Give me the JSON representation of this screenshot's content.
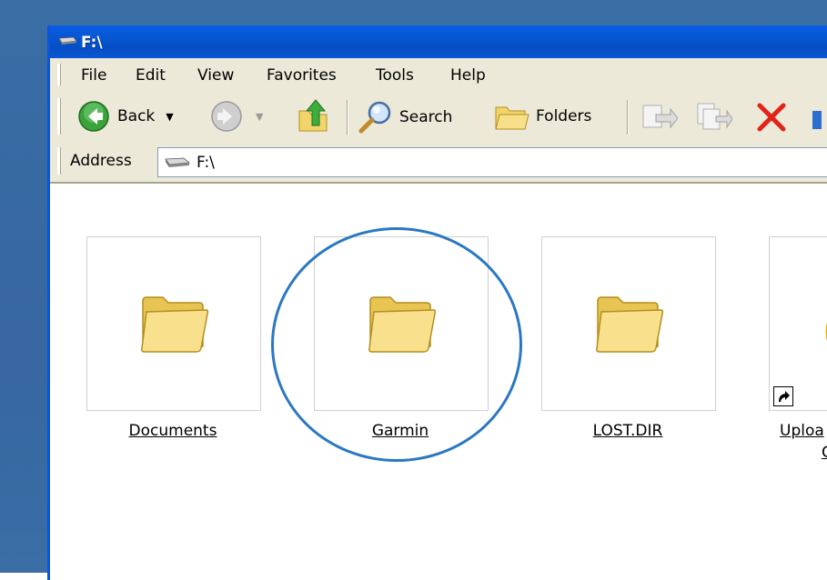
{
  "window": {
    "title": "F:\\"
  },
  "menubar": {
    "items": [
      "File",
      "Edit",
      "View",
      "Favorites",
      "Tools",
      "Help"
    ]
  },
  "toolbar": {
    "back_label": "Back",
    "search_label": "Search",
    "folders_label": "Folders"
  },
  "addressbar": {
    "label": "Address",
    "value": "F:\\"
  },
  "content": {
    "items": [
      {
        "name": "Documents",
        "type": "folder"
      },
      {
        "name": "Garmin",
        "type": "folder"
      },
      {
        "name": "LOST.DIR",
        "type": "folder"
      },
      {
        "name": "Uploa",
        "name_line2": "C",
        "type": "shortcut"
      }
    ]
  },
  "colors": {
    "desktop_blue": "#3a6ea5",
    "titlebar_blue": "#0758d6",
    "chrome": "#ece9d8",
    "highlight_circle": "#2a78c2"
  }
}
